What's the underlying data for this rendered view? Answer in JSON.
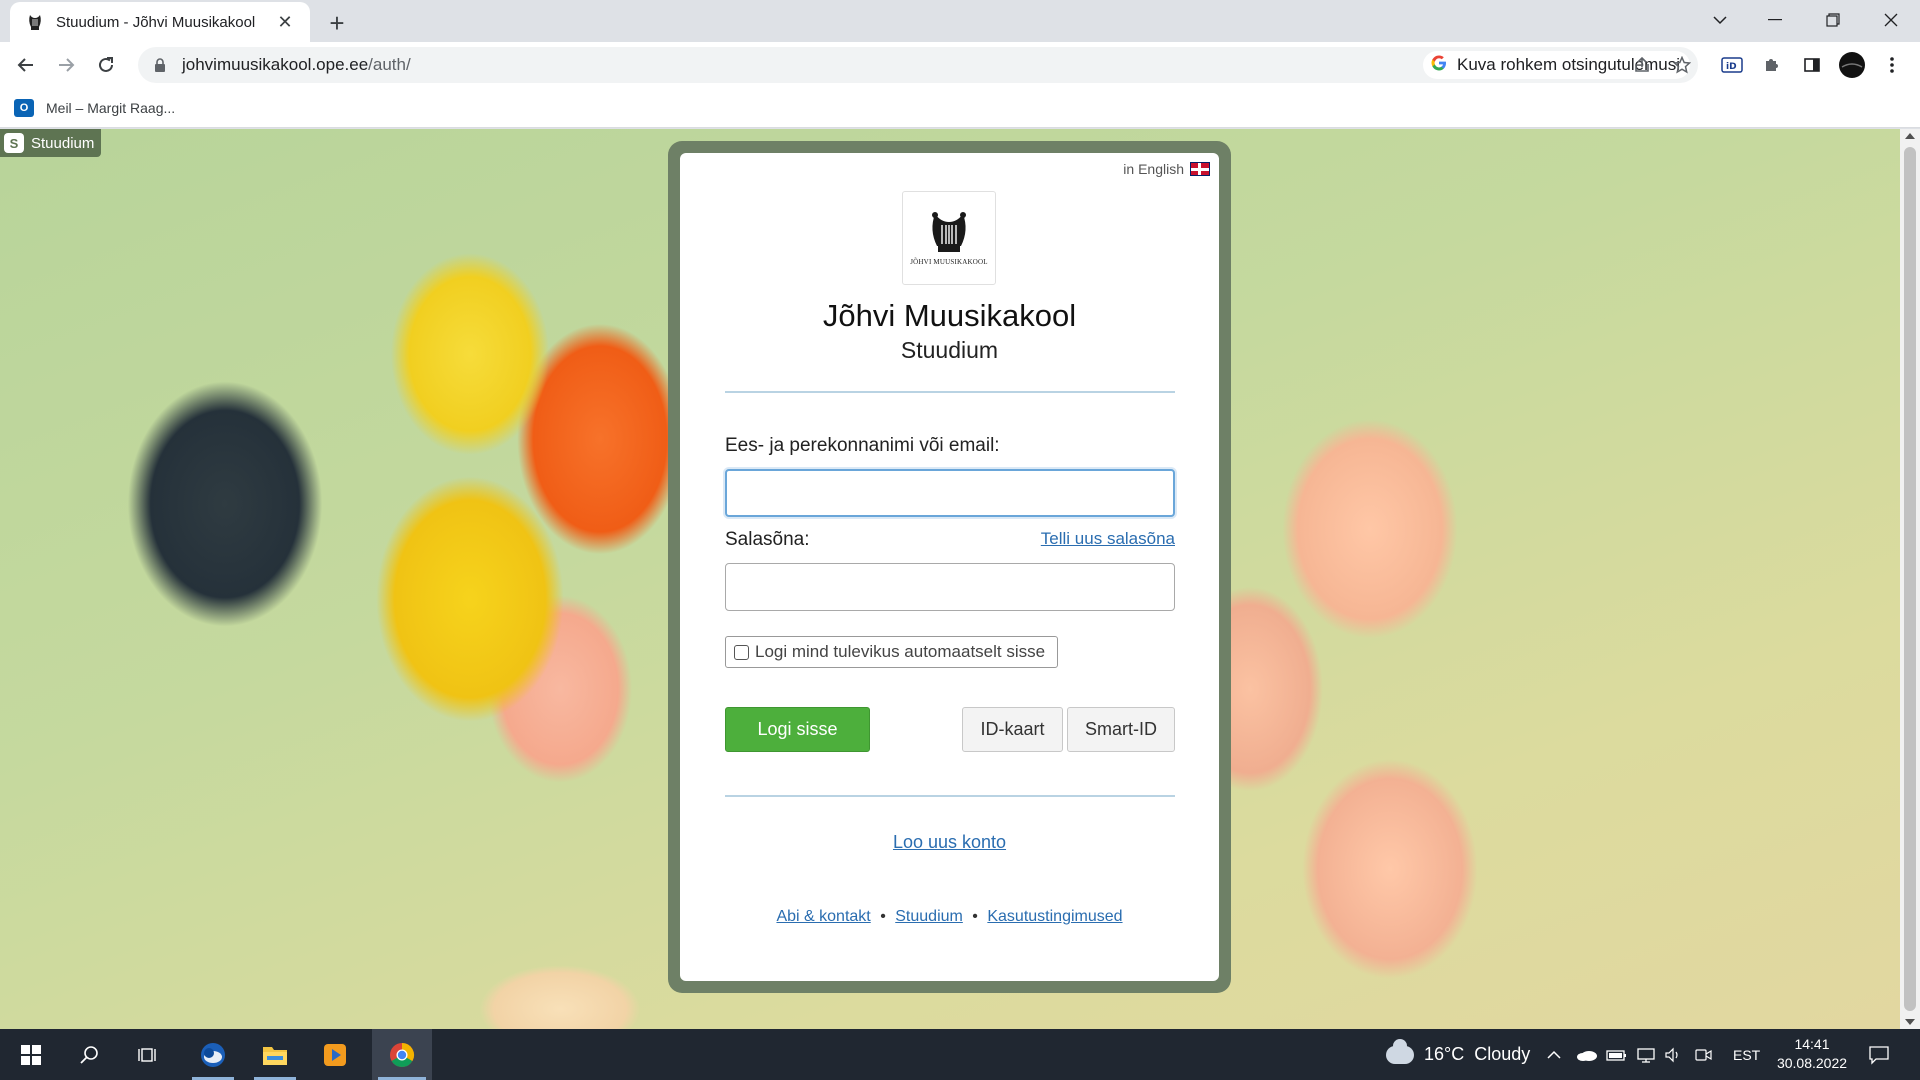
{
  "browser": {
    "tab_title": "Stuudium - Jõhvi Muusikakool",
    "url_host": "johvimuusikakool.ope.ee",
    "url_path": "/auth/",
    "lens_label": "Kuva rohkem otsingutulemusi",
    "bookmark_label": "Meil – Margit Raag..."
  },
  "page": {
    "badge_label": "Stuudium",
    "badge_letter": "S",
    "language_link": "in English",
    "logo_caption": "JÕHVI MUUSIKAKOOL",
    "school_name": "Jõhvi Muusikakool",
    "subtitle": "Stuudium",
    "username_label": "Ees- ja perekonnanimi või email:",
    "username_value": "",
    "password_label": "Salasõna:",
    "password_value": "",
    "forgot_password": "Telli uus salasõna",
    "remember_label": "Logi mind tulevikus automaatselt sisse",
    "remember_checked": false,
    "login_button": "Logi sisse",
    "id_card_button": "ID-kaart",
    "smart_id_button": "Smart-ID",
    "new_account": "Loo uus konto",
    "footer": {
      "help": "Abi & kontakt",
      "stuudium": "Stuudium",
      "terms": "Kasutustingimused",
      "separator": "•"
    }
  },
  "taskbar": {
    "weather": "16°C  Cloudy",
    "language": "EST",
    "time": "14:41",
    "date": "30.08.2022"
  },
  "colors": {
    "accent_green": "#4daf3c",
    "frame": "#6e8066",
    "link": "#2a6db0"
  }
}
